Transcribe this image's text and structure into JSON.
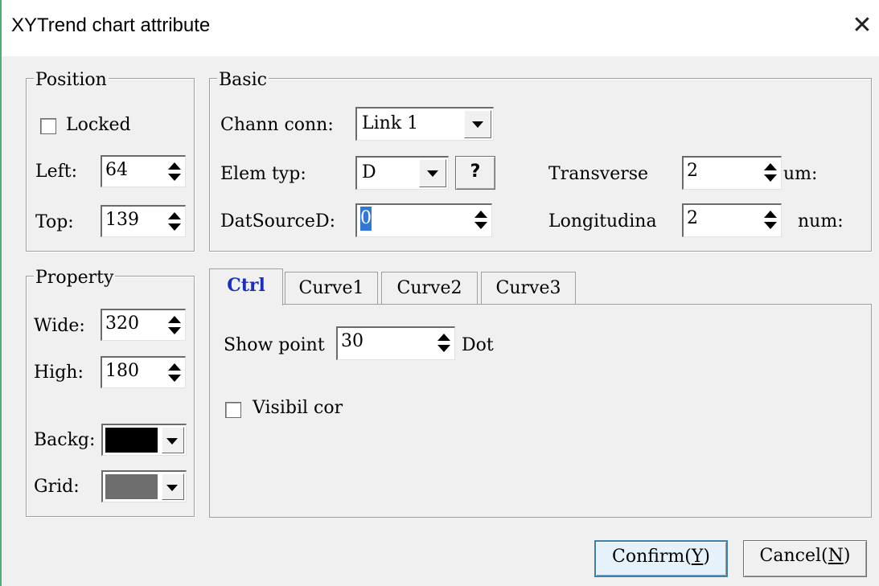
{
  "window": {
    "title": "XYTrend chart attribute"
  },
  "position_group": {
    "legend": "Position",
    "locked_label": "Locked",
    "locked_checked": false,
    "left_label": "Left:",
    "left_value": "64",
    "top_label": "Top:",
    "top_value": "139"
  },
  "basic_group": {
    "legend": "Basic",
    "chann_conn_label": "Chann conn:",
    "chann_conn_value": "Link 1",
    "elem_typ_label": "Elem typ:",
    "elem_typ_value": "D",
    "help_button": "?",
    "datsource_label": "DatSourceD:",
    "datsource_value": "0",
    "transverse_label": "Transverse",
    "transverse_value": "2",
    "transverse_suffix": "um:",
    "longitudinal_label": "Longitudina",
    "longitudinal_value": "2",
    "longitudinal_suffix": "num:"
  },
  "property_group": {
    "legend": "Property",
    "wide_label": "Wide:",
    "wide_value": "320",
    "high_label": "High:",
    "high_value": "180",
    "backg_label": "Backg:",
    "backg_color": "#000000",
    "grid_label": "Grid:",
    "grid_color": "#6e6e6e"
  },
  "tabs": [
    {
      "label": "Ctrl",
      "active": true
    },
    {
      "label": "Curve1",
      "active": false
    },
    {
      "label": "Curve2",
      "active": false
    },
    {
      "label": "Curve3",
      "active": false
    }
  ],
  "ctrl_tab": {
    "show_point_label": "Show point",
    "show_point_value": "30",
    "dot_label": "Dot",
    "visibil_label": "Visibil cor",
    "visibil_checked": false
  },
  "buttons": {
    "confirm_text": "Confirm(",
    "confirm_key": "Y",
    "confirm_close": ")",
    "cancel_text": "Cancel(",
    "cancel_key": "N",
    "cancel_close": ")"
  },
  "colors": {
    "accent": "#1a2fbf",
    "frame": "#4caf73",
    "default_button": "#3c7fb1"
  }
}
